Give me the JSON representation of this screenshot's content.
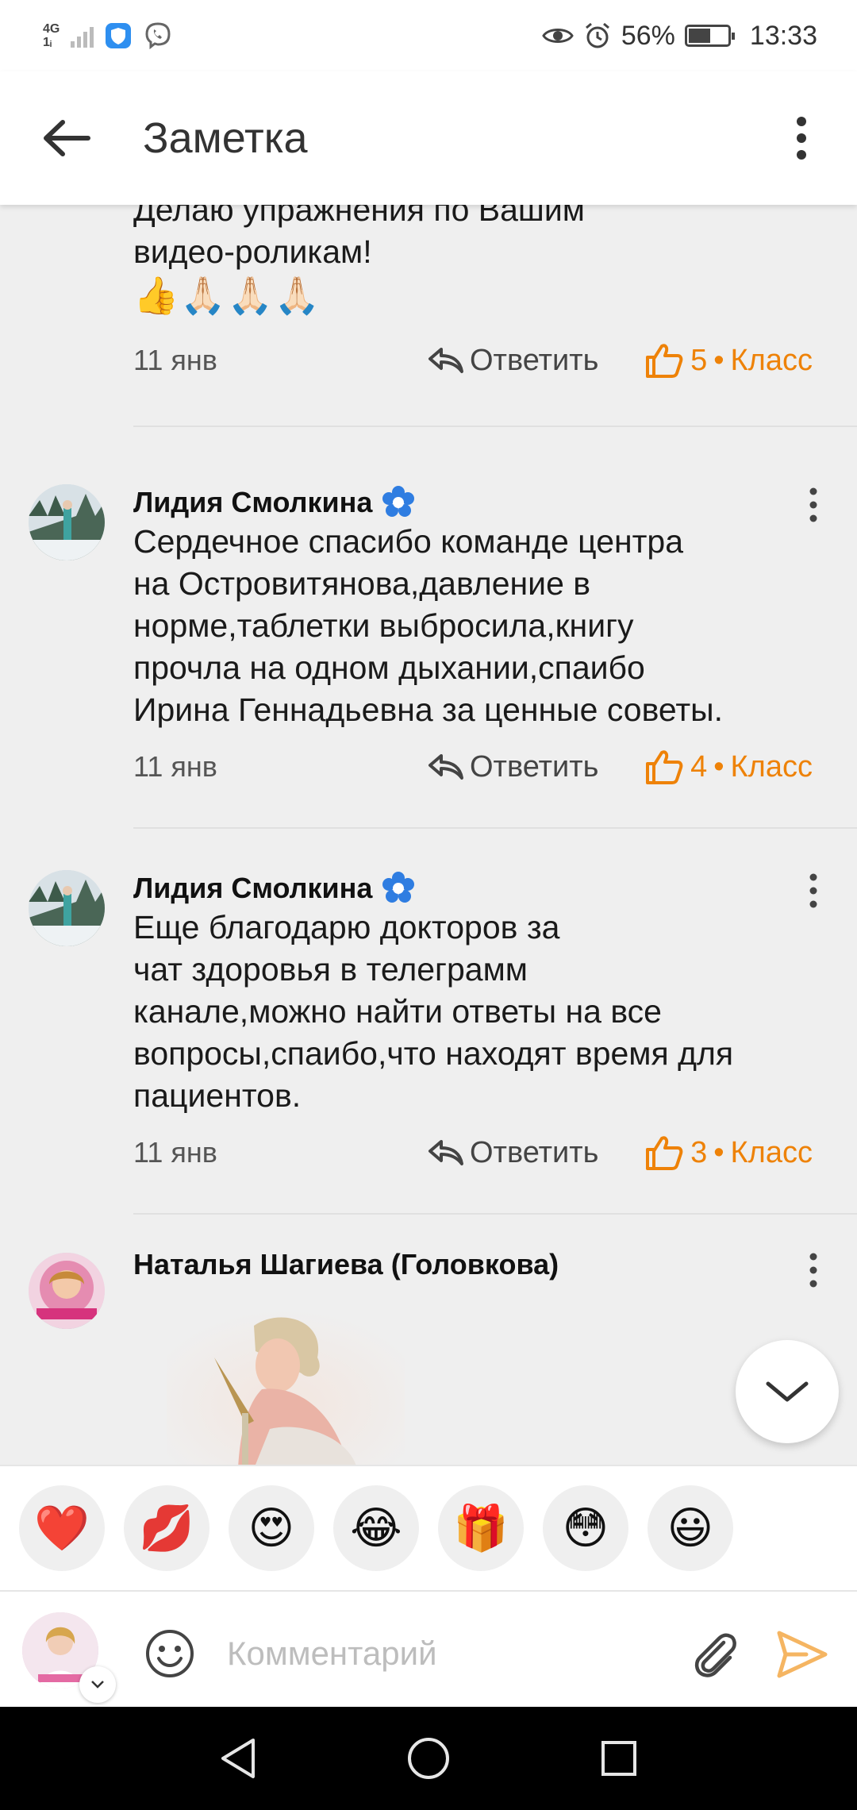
{
  "status_bar": {
    "network": "4G",
    "network_sub": "1ᵢ",
    "battery": "56%",
    "battery_level": 0.56,
    "time": "13:33"
  },
  "app_bar": {
    "title": "Заметка"
  },
  "comments": [
    {
      "text_lines": [
        "Делаю упражнения по Вашим",
        "видео-роликам!"
      ],
      "emoji": "👍🙏🏻🙏🏻🙏🏻",
      "date": "11 янв",
      "reply_label": "Ответить",
      "likes": "5",
      "klass_label": "Класс"
    },
    {
      "author": "Лидия Смолкина",
      "text_lines": [
        "Сердечное спасибо команде центра",
        "на Островитянова,давление в",
        "норме,таблетки выбросила,книгу",
        "прочла на одном дыхании,спаибо",
        "Ирина Геннадьевна за ценные советы."
      ],
      "date": "11 янв",
      "reply_label": "Ответить",
      "likes": "4",
      "klass_label": "Класс"
    },
    {
      "author": "Лидия Смолкина",
      "text_lines": [
        "Еще благодарю докторов за",
        "чат здоровья в телеграмм",
        "канале,можно найти ответы на все",
        "вопросы,спаибо,что находят время для",
        "пациентов."
      ],
      "date": "11 янв",
      "reply_label": "Ответить",
      "likes": "3",
      "klass_label": "Класс"
    },
    {
      "author": "Наталья Шагиева (Головкова)"
    }
  ],
  "reactions": [
    "❤️",
    "💋",
    "😍",
    "😂",
    "🎁",
    "😳",
    "😃"
  ],
  "comment_input": {
    "placeholder": "Комментарий"
  },
  "colors": {
    "accent": "#ee8208",
    "badge_blue": "#2f7de1"
  }
}
